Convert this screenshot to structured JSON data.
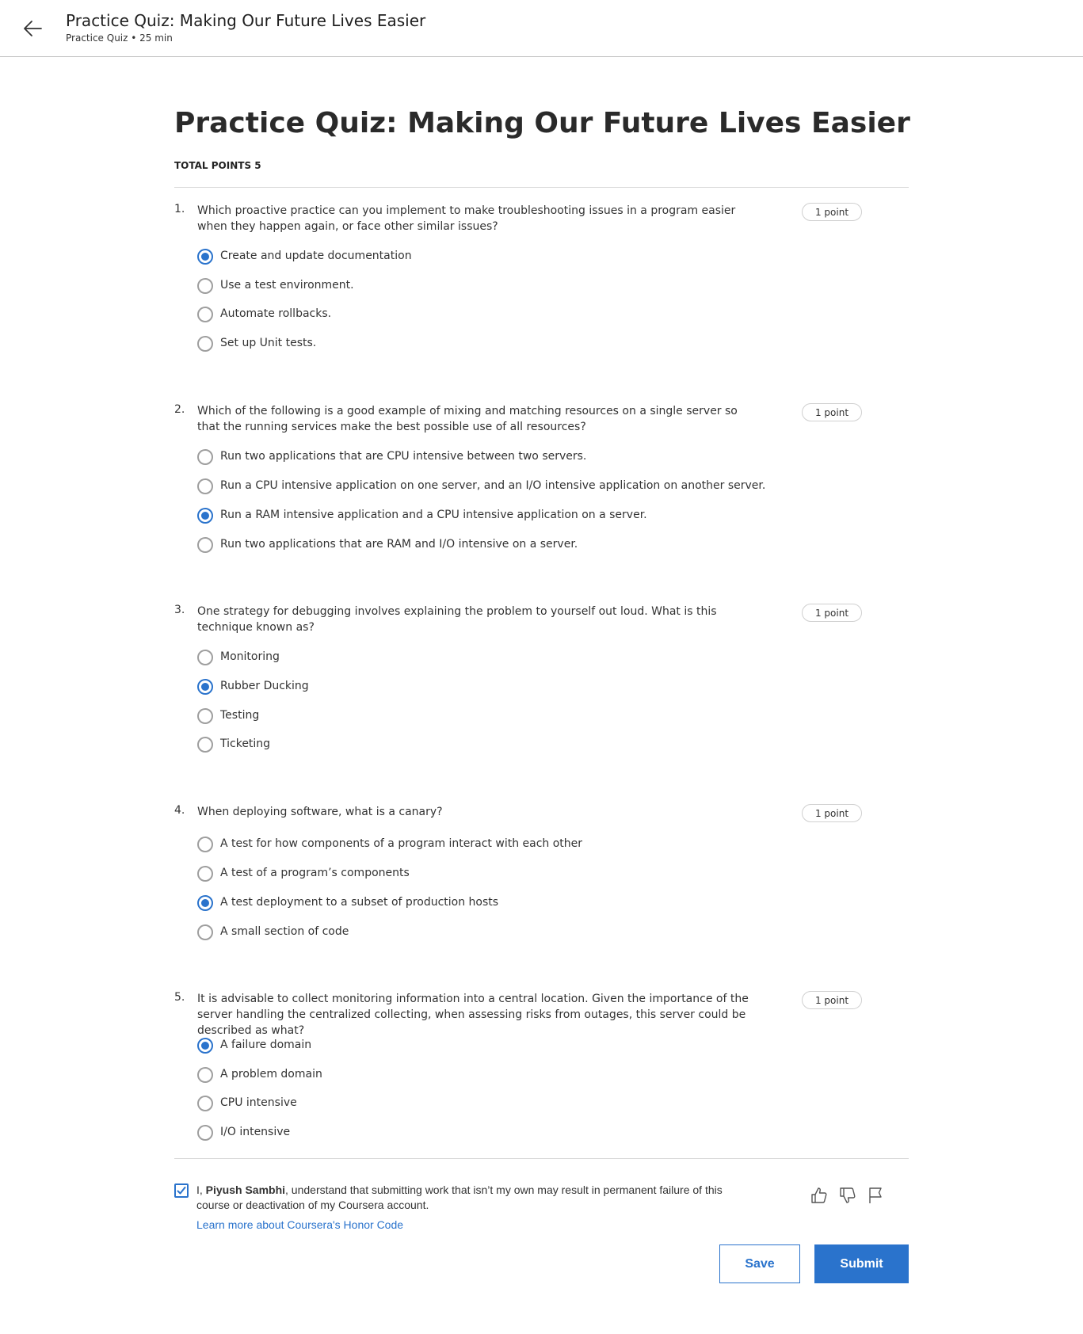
{
  "header": {
    "title": "Practice Quiz: Making Our Future Lives Easier",
    "subtitle": "Practice Quiz • 25 min"
  },
  "quiz": {
    "title": "Practice Quiz: Making Our Future Lives Easier",
    "total_points": "TOTAL POINTS 5",
    "questions": [
      {
        "number": "1.",
        "text": "Which proactive practice can you implement to make troubleshooting issues in a program easier when they happen again, or face other similar issues?",
        "points": "1 point",
        "options": [
          "Create and update documentation",
          "Use a test environment.",
          "Automate rollbacks.",
          "Set up Unit tests."
        ],
        "selected": "Create and update documentation"
      },
      {
        "number": "2.",
        "text": "Which of the following is a good example of mixing and matching resources on a single server so that the running services make the best possible use of all resources?",
        "points": "1 point",
        "options": [
          "Run two applications that are CPU intensive between two servers.",
          "Run a CPU intensive application on one server, and an I/O intensive application on another server.",
          "Run a RAM intensive application and a CPU intensive application on a server.",
          "Run two applications that are RAM and I/O intensive on a server."
        ],
        "selected": "Run a RAM intensive application and a CPU intensive application on a server."
      },
      {
        "number": "3.",
        "text": "One strategy for debugging involves explaining the problem to yourself out loud. What is this technique known as?",
        "points": "1 point",
        "options": [
          "Monitoring",
          "Rubber Ducking",
          "Testing",
          "Ticketing"
        ],
        "selected": "Rubber Ducking"
      },
      {
        "number": "4.",
        "text": "When deploying software, what is a canary?",
        "points": "1 point",
        "options": [
          "A test for how components of a program interact with each other",
          "A test of a program’s components",
          "A test deployment to a subset of production hosts",
          "A small section of code"
        ],
        "selected": "A test deployment to a subset of production hosts"
      },
      {
        "number": "5.",
        "text": "It is advisable to collect monitoring information into a central location. Given the importance of the server handling the centralized collecting, when assessing risks from outages, this server could be described as what?",
        "points": "1 point",
        "options": [
          "A failure domain",
          "A problem domain",
          "CPU intensive",
          "I/O intensive"
        ],
        "selected": "A failure domain"
      }
    ]
  },
  "honor_code": {
    "checked": true,
    "prefix": "I, ",
    "name": "Piyush Sambhi",
    "suffix": ", understand that submitting work that isn’t my own may result in permanent failure of this course or deactivation of my Coursera account.",
    "link": "Learn more about Coursera's Honor Code"
  },
  "feedback_icons": [
    "thumbs-up-icon",
    "thumbs-down-icon",
    "flag-icon"
  ],
  "actions": {
    "save": "Save",
    "submit": "Submit"
  },
  "colors": {
    "accent": "#2a73cc",
    "text": "#333333",
    "divider": "#d9d9d9"
  }
}
